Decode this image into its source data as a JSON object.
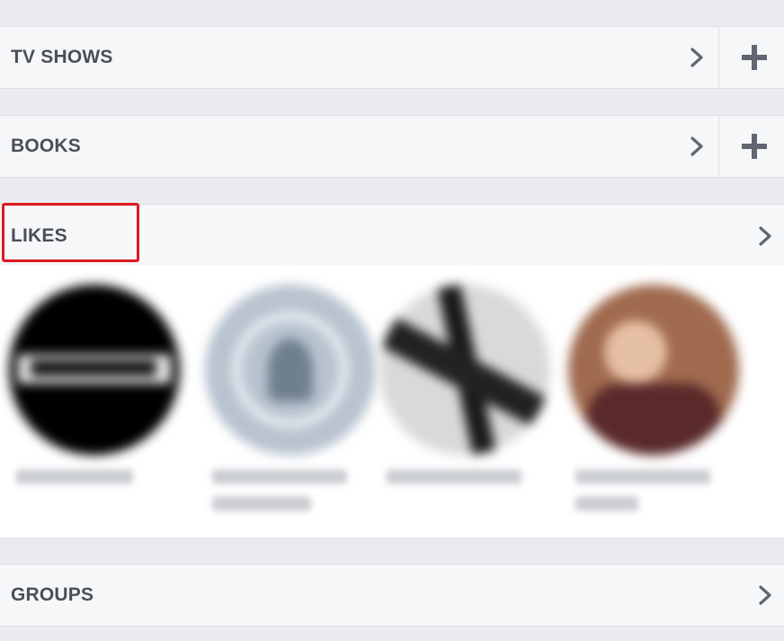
{
  "sections": {
    "tv_shows": {
      "title": "TV SHOWS"
    },
    "books": {
      "title": "BOOKS"
    },
    "likes": {
      "title": "LIKES",
      "items": [
        {
          "name": "blurred-like-1"
        },
        {
          "name": "blurred-like-2"
        },
        {
          "name": "blurred-like-3"
        },
        {
          "name": "blurred-like-4"
        }
      ]
    },
    "groups": {
      "title": "GROUPS"
    }
  },
  "icons": {
    "chevron": "chevron-right-icon",
    "plus": "plus-icon"
  },
  "colors": {
    "page_bg": "#e9ebee",
    "header_bg": "#f6f7f9",
    "title_text": "#4b4f56",
    "icon": "#606770",
    "highlight": "#e0181f"
  }
}
